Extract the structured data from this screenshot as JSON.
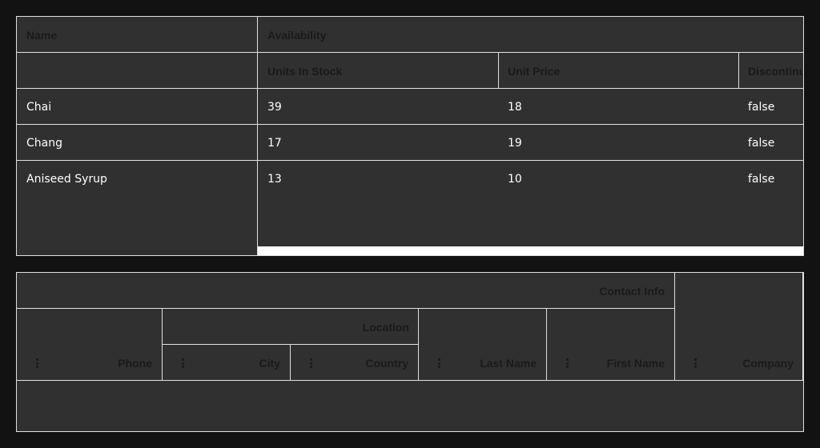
{
  "grid1": {
    "header": {
      "name": "Name",
      "availability": "Availability",
      "units_in_stock": "Units In Stock",
      "unit_price": "Unit Price",
      "discontinued": "Discontinued"
    },
    "rows": [
      {
        "name": "Chai",
        "units_in_stock": "39",
        "unit_price": "18",
        "discontinued": "false"
      },
      {
        "name": "Chang",
        "units_in_stock": "17",
        "unit_price": "19",
        "discontinued": "false"
      },
      {
        "name": "Aniseed Syrup",
        "units_in_stock": "13",
        "unit_price": "10",
        "discontinued": "false"
      }
    ]
  },
  "grid2": {
    "header": {
      "contact_info": "Contact Info",
      "location": "Location",
      "phone": "Phone",
      "city": "City",
      "country": "Country",
      "last_name": "Last Name",
      "first_name": "First Name",
      "company": "Company"
    },
    "icons": {
      "column_menu": "more-vertical-icon"
    }
  },
  "colors": {
    "background": "#121212",
    "grid_background": "#303030",
    "border": "#e0e0e0",
    "header_text": "#1a1a1a",
    "cell_text": "#ffffff"
  }
}
